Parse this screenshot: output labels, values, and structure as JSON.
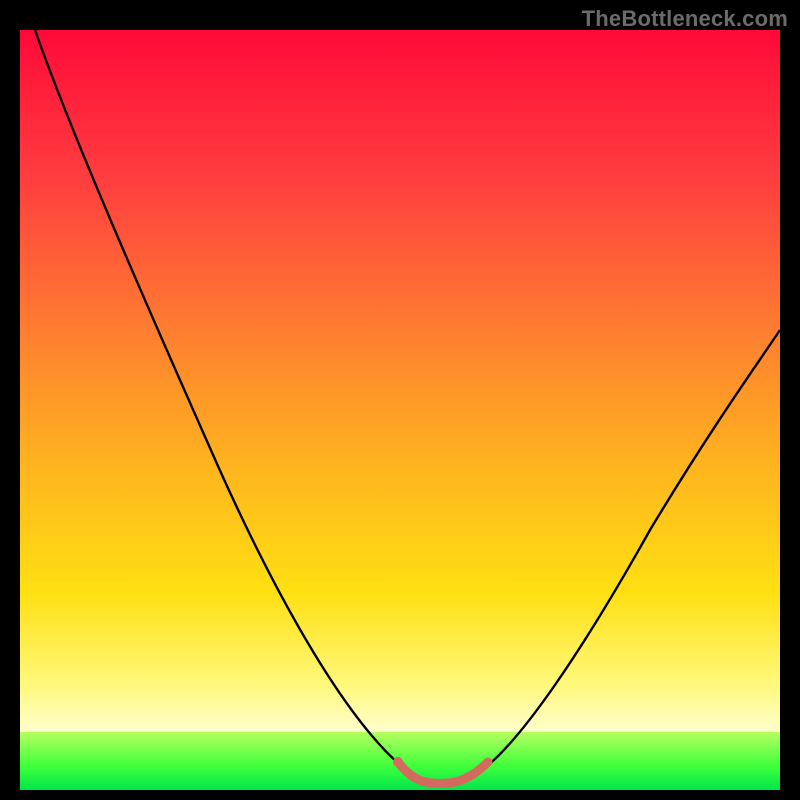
{
  "watermark": "TheBottleneck.com",
  "gradient_colors": {
    "top": "#ff0a3a",
    "mid_orange": "#ff7f30",
    "mid_yellow": "#ffe012",
    "pale": "#ffffcc",
    "green_top": "#b5ff5e",
    "green_bottom": "#00e64a"
  },
  "chart_data": {
    "type": "line",
    "title": "",
    "xlabel": "",
    "ylabel": "",
    "xlim": [
      0,
      100
    ],
    "ylim": [
      0,
      100
    ],
    "grid": false,
    "legend": false,
    "series": [
      {
        "name": "black-curve",
        "color": "#000000",
        "x": [
          2,
          10,
          20,
          30,
          40,
          46,
          50,
          54,
          58,
          62,
          70,
          80,
          90,
          100
        ],
        "y": [
          100,
          82,
          60,
          40,
          22,
          10,
          3,
          1,
          1,
          3,
          12,
          28,
          44,
          58
        ]
      },
      {
        "name": "floor-marker",
        "color": "#d46a5f",
        "x": [
          50,
          52,
          54,
          56,
          58,
          60,
          62
        ],
        "y": [
          3,
          1.8,
          1,
          0.8,
          1,
          1.8,
          3
        ]
      }
    ],
    "annotations": []
  }
}
